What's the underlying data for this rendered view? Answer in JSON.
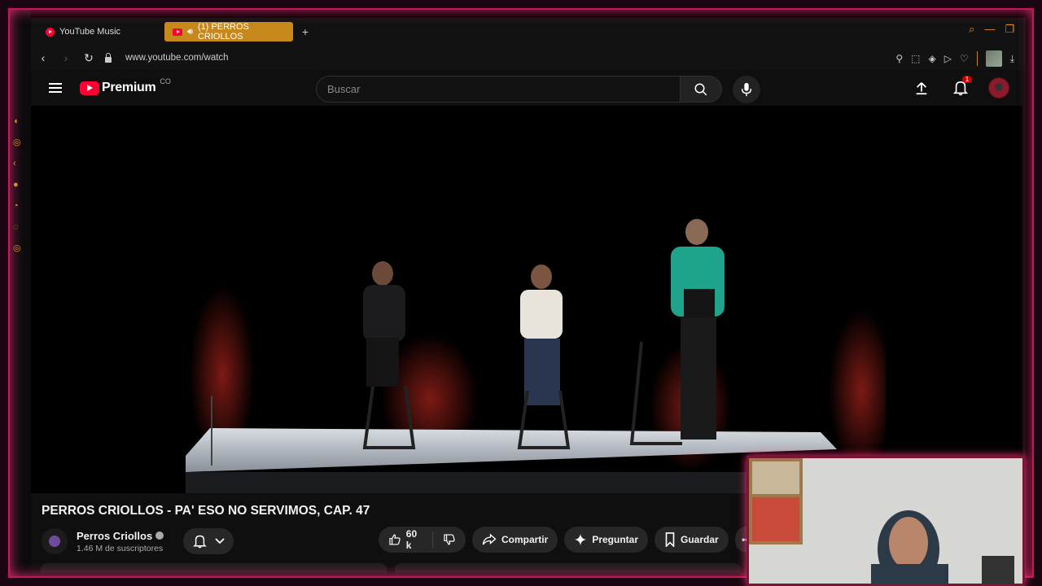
{
  "browser": {
    "tabs": [
      {
        "label": "YouTube Music",
        "active": false
      },
      {
        "label": "(1) PERROS CRIOLLOS",
        "active": true
      }
    ],
    "new_tab": "+",
    "url": "www.youtube.com/watch"
  },
  "youtube": {
    "logo_text": "Premium",
    "country": "CO",
    "search_placeholder": "Buscar",
    "notification_count": "1"
  },
  "video": {
    "title": "PERROS CRIOLLOS - PA' ESO NO SERVIMOS, CAP. 47",
    "channel_name": "Perros Criollos",
    "subscribers": "1.46 M de suscriptores",
    "likes": "60 k",
    "share_label": "Compartir",
    "ask_label": "Preguntar",
    "save_label": "Guardar"
  },
  "colors": {
    "accent_frame": "#c2185b",
    "active_tab": "#c7891c",
    "youtube_red": "#ff0033"
  }
}
